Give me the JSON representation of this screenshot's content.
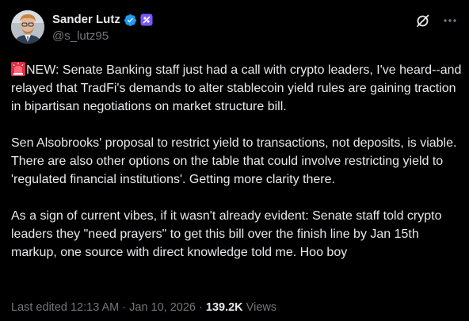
{
  "author": {
    "display_name": "Sander Lutz",
    "handle": "@s_lutz95",
    "verified_color": "#1d9bf0",
    "affiliate_badge_color": "#7856ff"
  },
  "top_actions": {
    "grok_icon": "grok-icon",
    "more_icon": "more-options-icon"
  },
  "tweet": {
    "paragraphs": [
      "NEW: Senate Banking staff just had a call with crypto leaders, I've heard--and relayed that TradFi's demands to alter stablecoin yield rules are gaining traction in bipartisan negotiations on market structure bill.",
      "Sen Alsobrooks' proposal to restrict yield to transactions, not deposits, is viable. There are also other options on the table that could involve restricting yield to 'regulated financial institutions'. Getting more clarity there.",
      "As a sign of current vibes, if it wasn't already evident: Senate staff told crypto leaders they \"need prayers\" to get this bill over the finish line by Jan 15th markup, one source with direct knowledge told me. Hoo boy"
    ],
    "leading_emoji": "siren-emoji"
  },
  "meta": {
    "edited_label": "Last edited 12:13 AM",
    "separator_1": " · ",
    "date": "Jan 10, 2026",
    "separator_2": " · ",
    "views_count": "139.2K",
    "views_label": " Views"
  },
  "colors": {
    "background": "#000000",
    "text": "#e7e9ea",
    "muted": "#71767b"
  }
}
